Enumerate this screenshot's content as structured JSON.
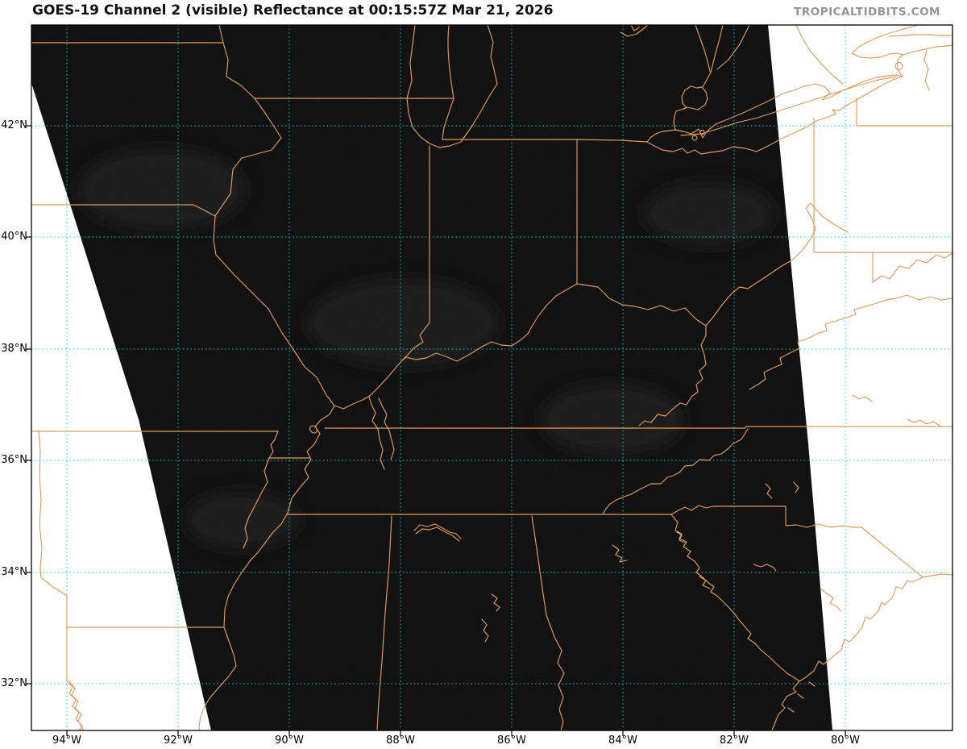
{
  "header": {
    "title": "GOES-19 Channel 2 (visible) Reflectance at 00:15:57Z Mar 21, 2026",
    "watermark": "TROPICALTIDBITS.COM"
  },
  "map_info": {
    "satellite": "GOES-19",
    "channel": "Channel 2 (visible)",
    "product": "Reflectance",
    "valid_time": "00:15:57Z Mar 21, 2026"
  },
  "axes": {
    "lat_labels": [
      "42°N",
      "40°N",
      "38°N",
      "36°N",
      "34°N",
      "32°N"
    ],
    "lon_labels": [
      "94°W",
      "92°W",
      "90°W",
      "88°W",
      "86°W",
      "84°W",
      "82°W",
      "80°W"
    ]
  },
  "colors": {
    "borders": "#e29b5b",
    "gridlines": "#00cfcf",
    "swath": "#0b0b0b",
    "no_data": "#ffffff",
    "frame": "#000000"
  }
}
